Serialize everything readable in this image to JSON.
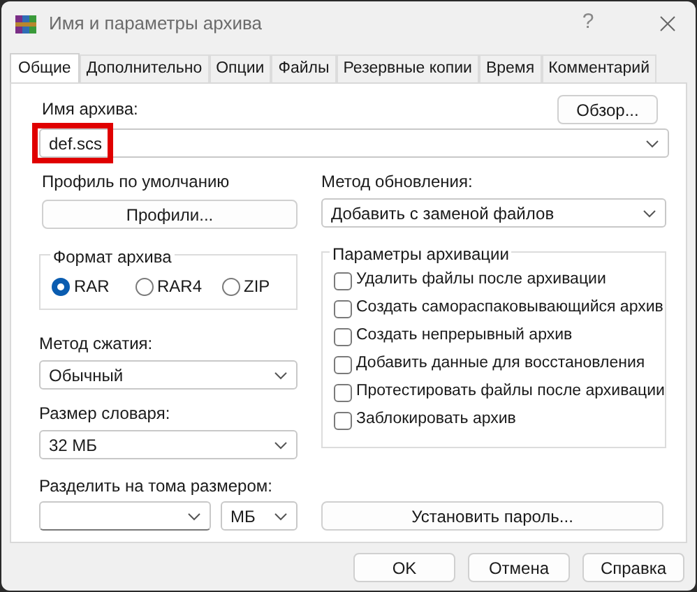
{
  "window": {
    "title": "Имя и параметры архива",
    "help": "?"
  },
  "tabs": [
    {
      "label": "Общие",
      "selected": true
    },
    {
      "label": "Дополнительно",
      "selected": false
    },
    {
      "label": "Опции",
      "selected": false
    },
    {
      "label": "Файлы",
      "selected": false
    },
    {
      "label": "Резервные копии",
      "selected": false
    },
    {
      "label": "Время",
      "selected": false
    },
    {
      "label": "Комментарий",
      "selected": false
    }
  ],
  "archive_name": {
    "label": "Имя архива:",
    "value": "def.scs",
    "browse": "Обзор...",
    "highlighted": true
  },
  "profile": {
    "label": "Профиль по умолчанию",
    "button": "Профили..."
  },
  "update_method": {
    "label": "Метод обновления:",
    "value": "Добавить с заменой файлов"
  },
  "format": {
    "title": "Формат архива",
    "options": [
      {
        "label": "RAR",
        "selected": true
      },
      {
        "label": "RAR4",
        "selected": false
      },
      {
        "label": "ZIP",
        "selected": false
      }
    ]
  },
  "compression": {
    "label": "Метод сжатия:",
    "value": "Обычный"
  },
  "dictionary": {
    "label": "Размер словаря:",
    "value": "32 МБ"
  },
  "options": {
    "title": "Параметры архивации",
    "items": [
      {
        "label": "Удалить файлы после архивации",
        "checked": false
      },
      {
        "label": "Создать самораспаковывающийся архив",
        "checked": false
      },
      {
        "label": "Создать непрерывный архив",
        "checked": false
      },
      {
        "label": "Добавить данные для восстановления",
        "checked": false
      },
      {
        "label": "Протестировать файлы после архивации",
        "checked": false
      },
      {
        "label": "Заблокировать архив",
        "checked": false
      }
    ]
  },
  "split": {
    "label": "Разделить на тома размером:",
    "unit": "МБ"
  },
  "password_button": "Установить пароль...",
  "buttons": [
    "OK",
    "Отмена",
    "Справка"
  ]
}
